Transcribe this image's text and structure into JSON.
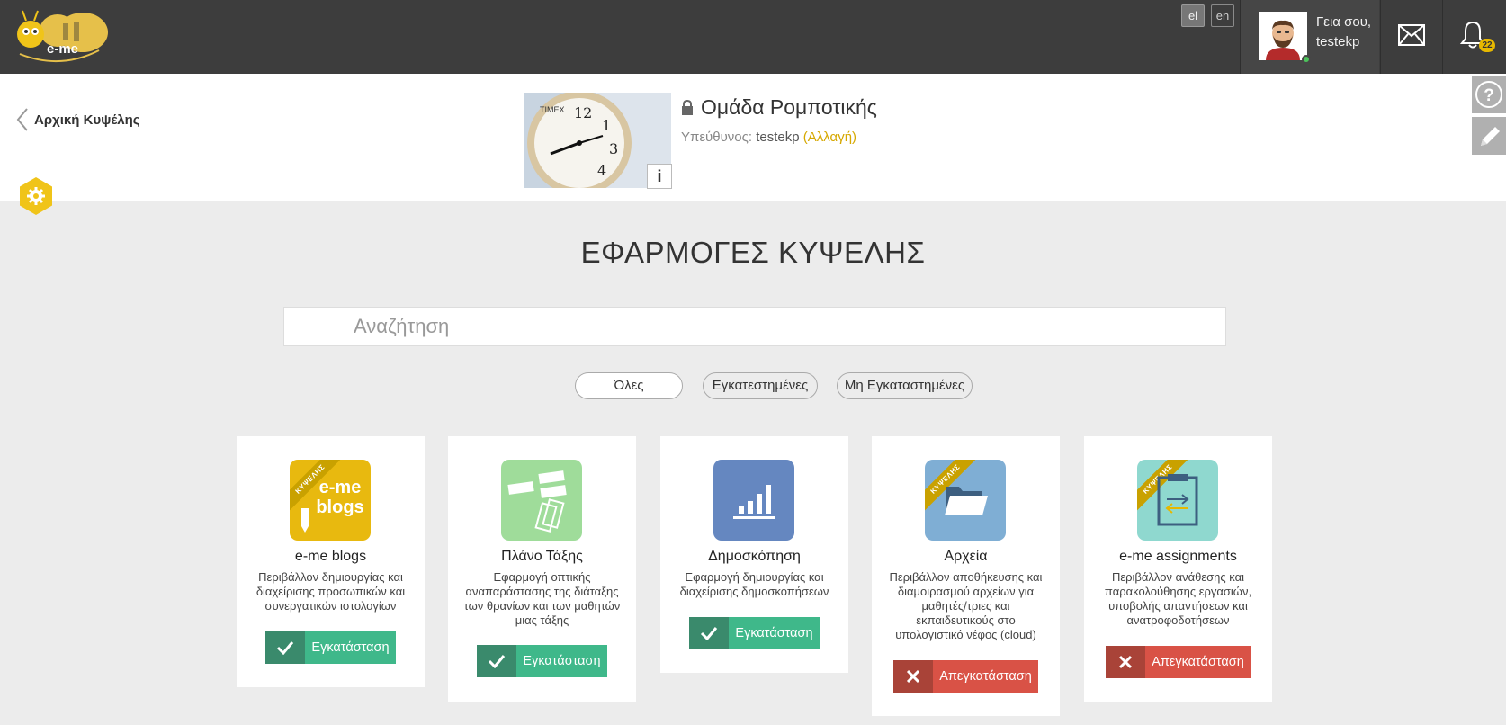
{
  "topbar": {
    "logo_text": "e-me",
    "languages": [
      {
        "code": "el",
        "active": true
      },
      {
        "code": "en",
        "active": false
      }
    ],
    "user": {
      "greeting": "Γεια σου,",
      "username": "testekp"
    },
    "notifications_count": "22"
  },
  "header": {
    "back_label": "Αρχική Κυψέλης",
    "group_name": "Ομάδα Ρομποτικής",
    "owner_label": "Υπεύθυνος:",
    "owner_name": "testekp",
    "change_label": "(Αλλαγή)",
    "info_label": "i"
  },
  "main": {
    "heading": "ΕΦΑΡΜΟΓΕΣ ΚΥΨΕΛΗΣ",
    "search_placeholder": "Αναζήτηση",
    "filters": [
      {
        "label": "Όλες",
        "active": true
      },
      {
        "label": "Εγκατεστημένες",
        "active": false
      },
      {
        "label": "Μη Εγκαταστημένες",
        "active": false
      }
    ]
  },
  "apps": [
    {
      "name": "e-me blogs",
      "description": "Περιβάλλον δημιουργίας και διαχείρισης προσωπικών και συνεργατικών ιστολογίων",
      "button": "Εγκατάσταση",
      "installed": false,
      "ribbon": "ΚΥΨΕΛΗΣ",
      "icon_text": "e-me blogs",
      "icon": "blogs-icon",
      "color": "#e8b90f"
    },
    {
      "name": "Πλάνο Τάξης",
      "description": "Εφαρμογή οπτικής αναπαράστασης της διάταξης των θρανίων και των μαθητών μιας τάξης",
      "button": "Εγκατάσταση",
      "installed": false,
      "ribbon": "",
      "icon": "classroom-plan-icon",
      "color": "#9fdc9a"
    },
    {
      "name": "Δημοσκόπηση",
      "description": "Εφαρμογή δημιουργίας και διαχείρισης δημοσκοπήσεων",
      "button": "Εγκατάσταση",
      "installed": false,
      "ribbon": "",
      "icon": "poll-chart-icon",
      "color": "#5f86c4"
    },
    {
      "name": "Αρχεία",
      "description": "Περιβάλλον αποθήκευσης και διαμοιρασμού αρχείων για μαθητές/τριες και εκπαιδευτικούς στο υπολογιστικό νέφος (cloud)",
      "button": "Απεγκατάσταση",
      "installed": true,
      "ribbon": "ΚΥΨΕΛΗΣ",
      "icon": "folder-icon",
      "color": "#7faed4"
    },
    {
      "name": "e-me assignments",
      "description": "Περιβάλλον ανάθεσης και παρακολούθησης εργασιών, υποβολής απαντήσεων και ανατροφοδοτήσεων",
      "button": "Απεγκατάσταση",
      "installed": true,
      "ribbon": "ΚΥΨΕΛΗΣ",
      "icon": "assignment-icon",
      "color": "#8fd8cf"
    }
  ]
}
